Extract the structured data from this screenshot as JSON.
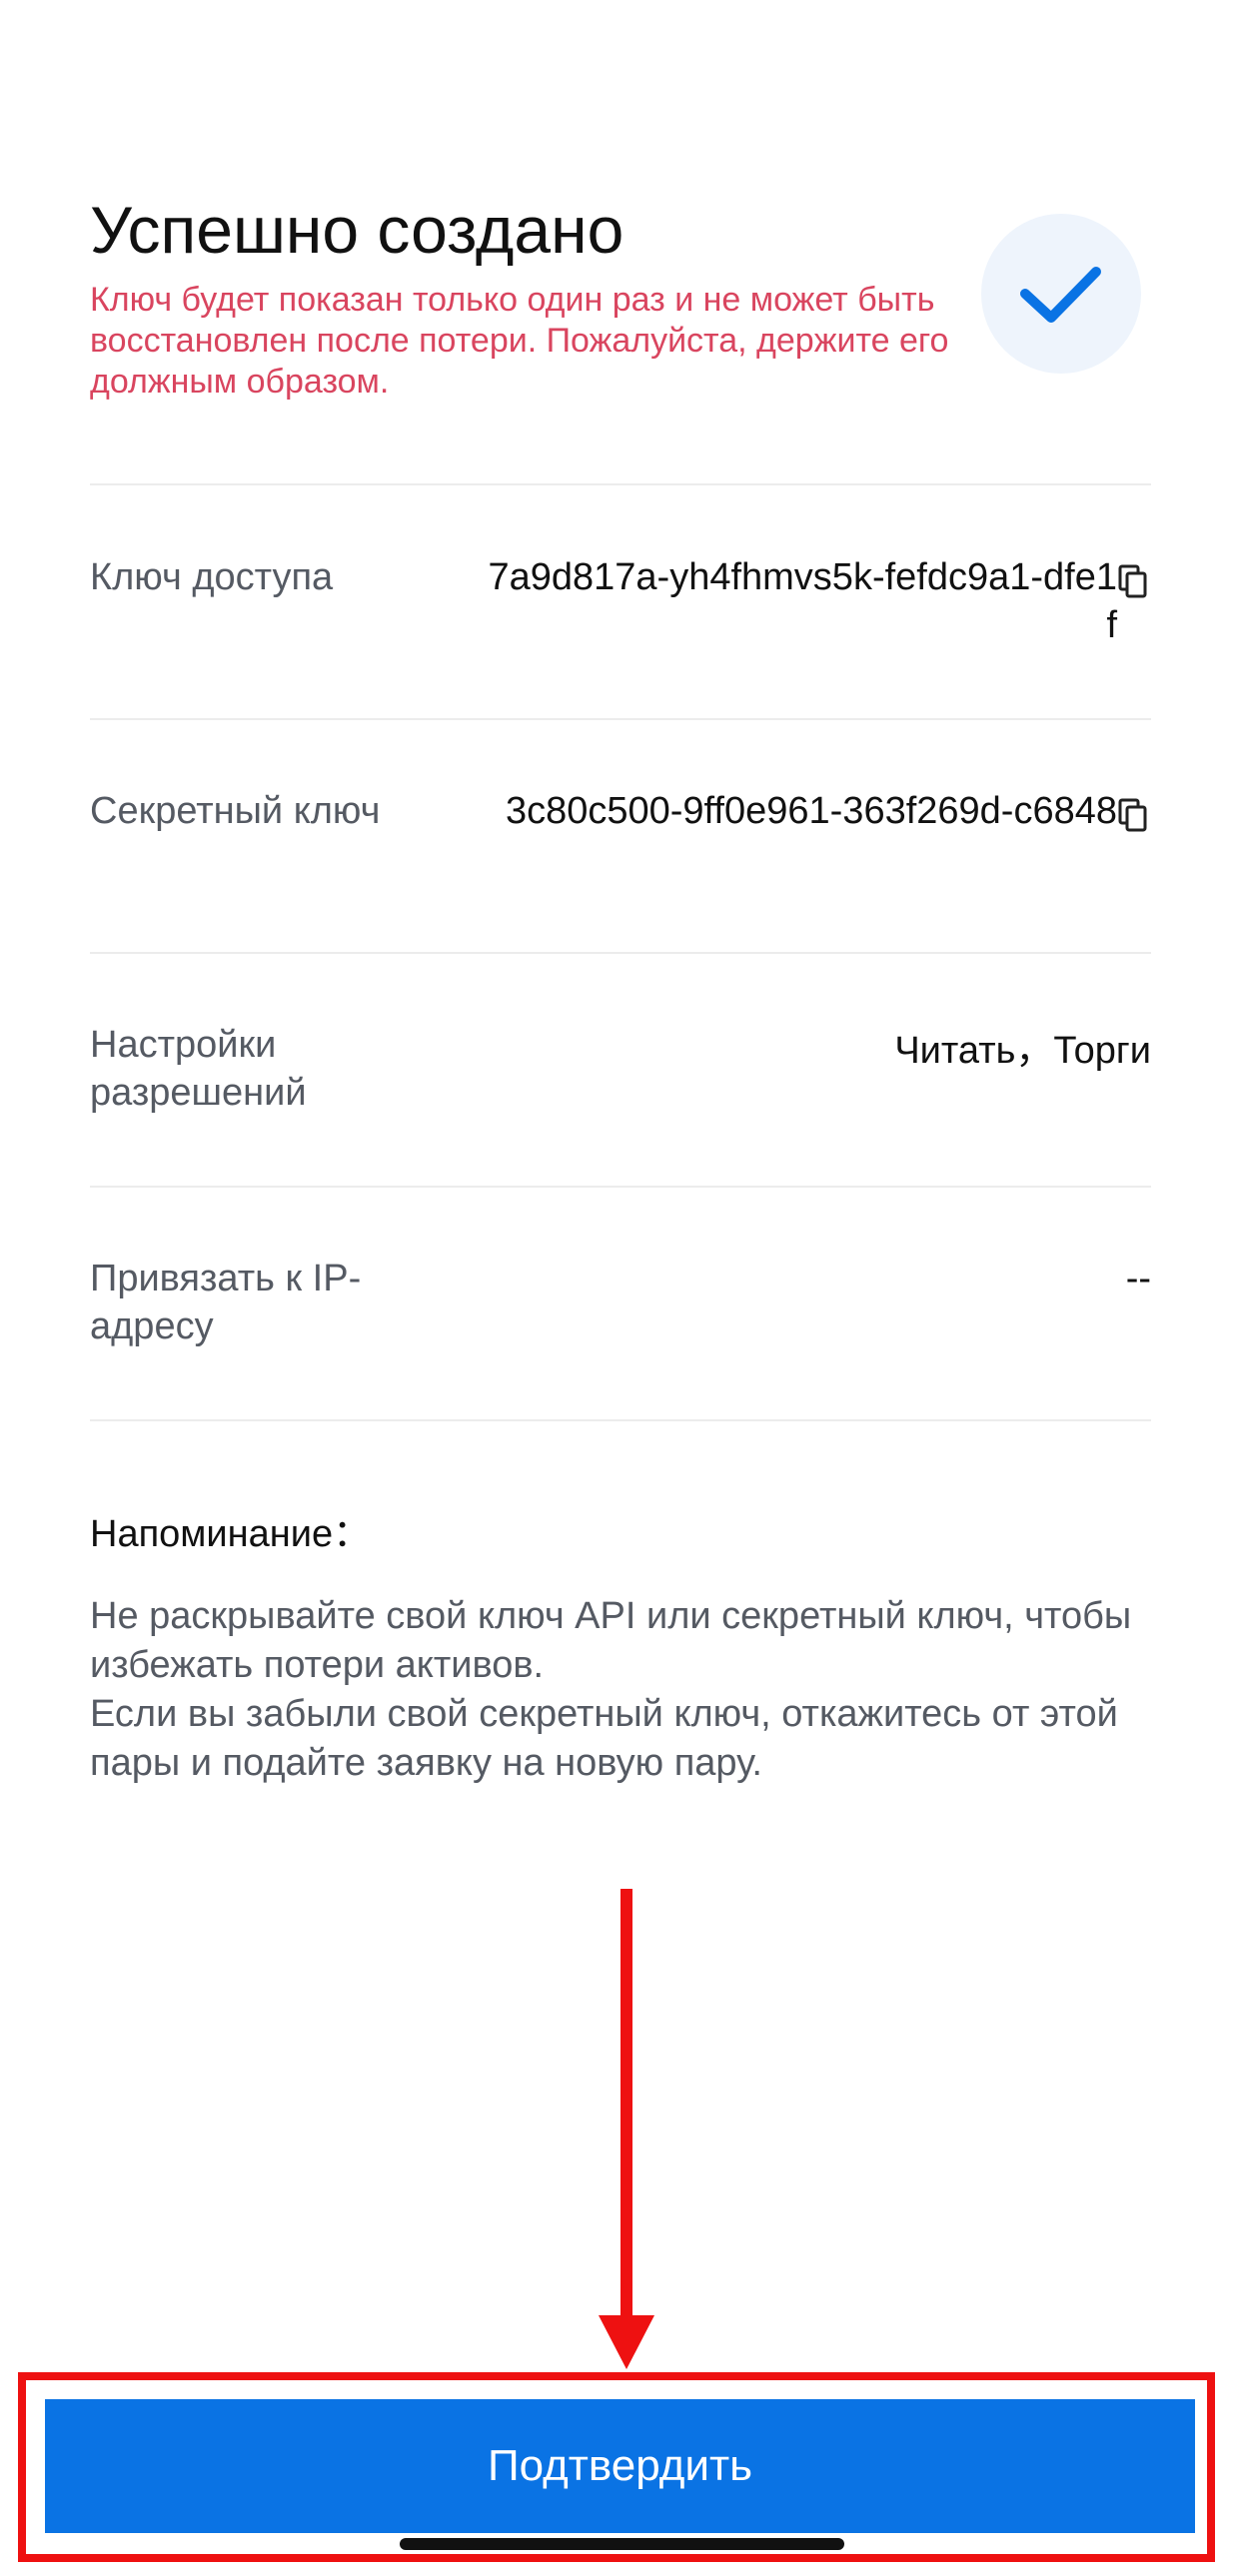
{
  "header": {
    "title": "Успешно создано",
    "warning": "Ключ будет показан только один раз и не может быть восстановлен после потери. Пожалуйста, держите его должным образом.",
    "status_icon": "checkmark-icon"
  },
  "rows": [
    {
      "label": "Ключ доступа",
      "value": "7a9d817a-yh4fhmvs5k-fefdc9a1-dfe1f",
      "icon": "copy-icon"
    },
    {
      "label": "Секретный ключ",
      "value": "3c80c500-9ff0e961-363f269d-c6848",
      "icon": "copy-icon"
    },
    {
      "label": "Настройки разрешений",
      "value": "Читать，Торги"
    },
    {
      "label": "Привязать к IP-адресу",
      "value": "--"
    }
  ],
  "reminder": {
    "title": "Напоминание：",
    "lines": [
      "Не раскрывайте свой ключ API или секретный ключ, чтобы избежать потери активов.",
      "Если вы забыли свой секретный ключ, откажитесь от этой пары и подайте заявку на новую пару."
    ]
  },
  "footer": {
    "confirm_label": "Подтвердить"
  },
  "colors": {
    "accent": "#0a73e4",
    "warning": "#d9455f",
    "annotation": "#ee1111"
  }
}
